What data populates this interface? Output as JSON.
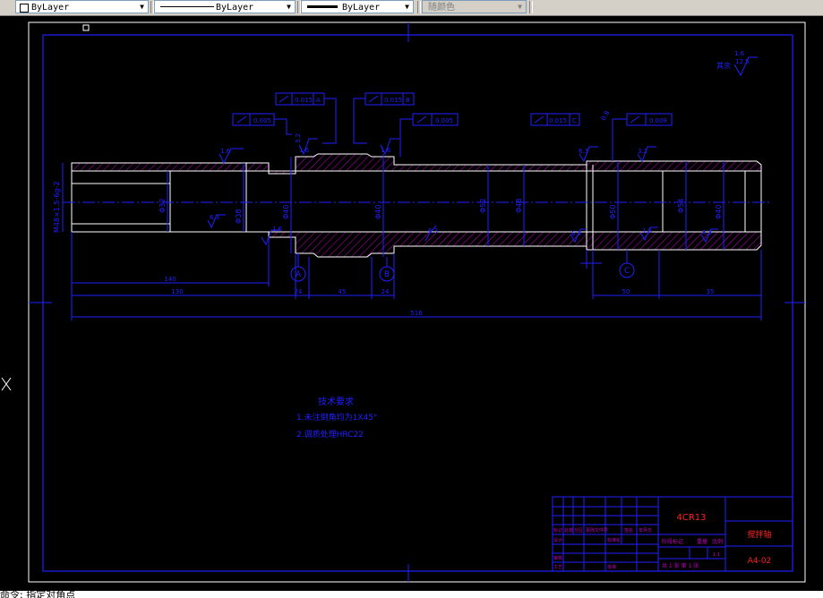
{
  "toolbar": {
    "color_value": "ByLayer",
    "linetype_value": "ByLayer",
    "lineweight_value": "ByLayer",
    "plotstyle_value": "随颜色"
  },
  "drawing": {
    "roughness_all": "其余",
    "roughness_all_value": "12.5",
    "gdt": {
      "f1_tol": "0.005",
      "f2_tol": "0.015",
      "f2_ref": "A",
      "f3_tol": "0.015",
      "f3_ref": "B",
      "f4_tol": "0.005",
      "f5_tol": "0.015",
      "f5_ref": "C",
      "f6_tol": "0.008"
    },
    "rough_labels": [
      "1.6",
      "3.2",
      "1.6",
      "1.6",
      "6.3",
      "3.2",
      "0.8",
      "6.3",
      "1.6",
      "6.3",
      "6.3",
      "1.6",
      "6.3",
      "1.6",
      "6.3",
      "1.6"
    ],
    "dim_labels": {
      "thread": "M48×1.5-6g-2",
      "d1": "Φ32",
      "d2": "Φ38",
      "d3": "Φ40",
      "d4": "Φ40",
      "d5": "Φ52",
      "d6": "Φ48",
      "d7": "Φ50",
      "d8": "Φ54",
      "d9": "Φ40"
    },
    "datums": [
      "A",
      "B",
      "C"
    ],
    "lengths": {
      "l1": "140",
      "l2": "130",
      "l3": "24",
      "l4": "45",
      "l5": "24",
      "l6": "50",
      "l7": "35",
      "total": "516"
    },
    "notes": {
      "title": "技术要求",
      "line1": "1.未注倒角均为1X45°",
      "line2": "2.调质处理HRC22"
    },
    "title_block": {
      "material": "4CR13",
      "part_name": "搅拌轴",
      "drawing_no": "A4-02",
      "scale_label": "比例",
      "weight_label": "重量",
      "stage_label": "阶段标记",
      "sheet_info": "共 1 张 第 1 张",
      "rows": [
        "标记",
        "处数",
        "分区",
        "更改文件号",
        "签名",
        "年月日"
      ],
      "designer": "设计",
      "standard": "标准化",
      "checker": "审核",
      "process": "工艺",
      "approve": "批准",
      "scale_value": "1:1"
    }
  },
  "command": {
    "text": "命令: 指定对角点"
  }
}
